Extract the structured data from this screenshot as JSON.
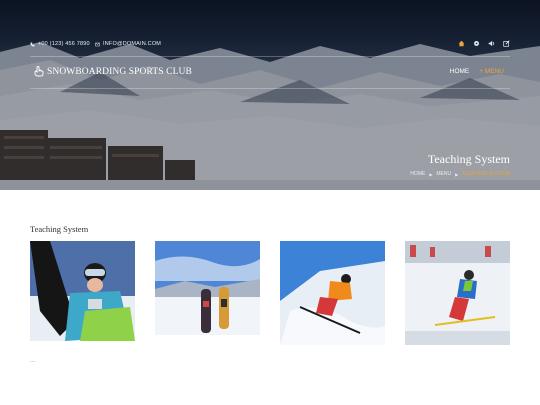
{
  "topbar": {
    "phone": "+00 (123) 456 7890",
    "email": "INFO@DOMAIN.COM",
    "social_icons": [
      "home-icon",
      "settings-icon",
      "speaker-icon",
      "edit-icon"
    ]
  },
  "brand": {
    "name": "SNOWBOARDING SPORTS CLUB",
    "icon": "hand-pointer-icon"
  },
  "nav": {
    "home": "HOME",
    "menu": "+ MENU"
  },
  "hero": {
    "heading": "Teaching System"
  },
  "breadcrumb": {
    "home": "HOME",
    "menu": "MENU",
    "current": "TEACHING SYSTEM"
  },
  "section": {
    "title": "Teaching System"
  },
  "gallery": [
    {
      "icon": "snowboarder-closeup-photo"
    },
    {
      "icon": "snowboards-in-snow-photo"
    },
    {
      "icon": "skier-orange-jacket-photo"
    },
    {
      "icon": "ski-racer-photo"
    }
  ],
  "footer_hint": "..."
}
